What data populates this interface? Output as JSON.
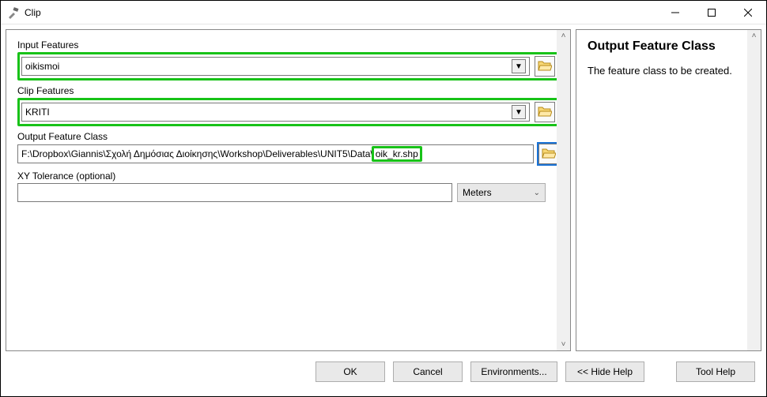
{
  "window": {
    "title": "Clip"
  },
  "fields": {
    "input_features_label": "Input Features",
    "input_features_value": "oikismoi",
    "clip_features_label": "Clip Features",
    "clip_features_value": "KRITI",
    "output_fc_label": "Output Feature Class",
    "output_fc_path_prefix": "F:\\Dropbox\\Giannis\\Σχολή Δημόσιας Διοίκησης\\Workshop\\Deliverables\\UNIT5\\Data\\",
    "output_fc_filename": "oik_kr.shp",
    "xy_tolerance_label": "XY Tolerance (optional)",
    "xy_tolerance_value": "",
    "units_value": "Meters"
  },
  "help": {
    "title": "Output Feature Class",
    "body": "The feature class to be created."
  },
  "buttons": {
    "ok": "OK",
    "cancel": "Cancel",
    "environments": "Environments...",
    "hide_help": "<< Hide Help",
    "tool_help": "Tool Help"
  }
}
